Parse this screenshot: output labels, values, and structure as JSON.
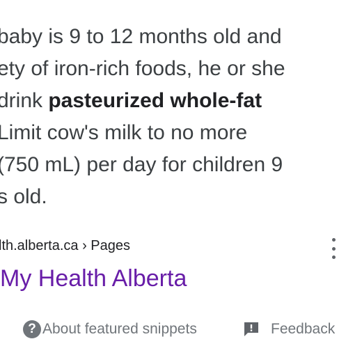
{
  "snippet": {
    "line1": "baby is 9 to 12 months old and",
    "line2": "ety of iron-rich foods, he or she",
    "line3_pre": "drink ",
    "line3_bold": "pasteurized whole-fat",
    "line4": " Limit cow's milk to no more",
    "line5": "(750 mL) per day for children 9",
    "line6": "s old."
  },
  "result": {
    "source": "lth.alberta.ca › Pages",
    "title": "My Health Alberta"
  },
  "footer": {
    "about_label": "About featured snippets",
    "feedback_label": "Feedback"
  },
  "icons": {
    "more": "more-vert-icon",
    "help": "help-circle-icon",
    "feedback": "feedback-icon"
  },
  "colors": {
    "text": "#3c4043",
    "link_visited": "#681da8",
    "muted": "#70757a"
  }
}
